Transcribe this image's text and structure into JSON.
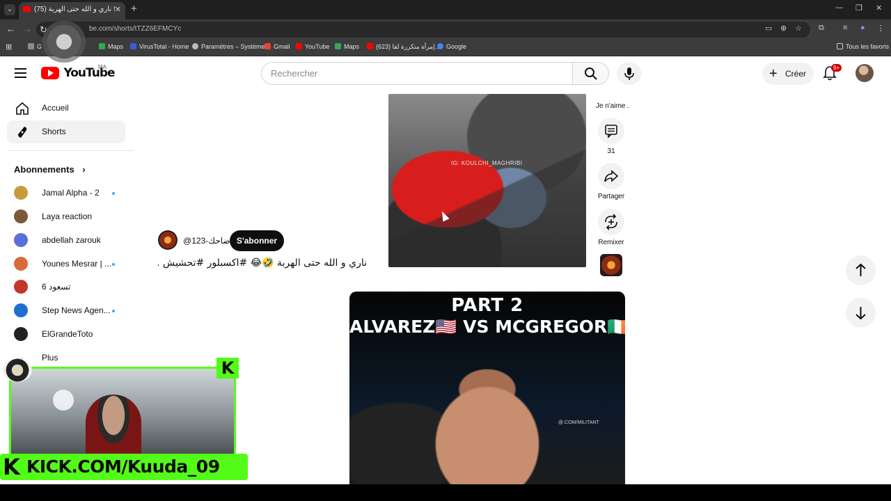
{
  "browser": {
    "tab_title": "(75) ناري و الله حتى الهربة ! ",
    "url": "be.com/shorts/tTZZ6EFMCYc",
    "bookmarks": [
      {
        "label": "G",
        "color": "#8c8c8c"
      },
      {
        "label": "Maps",
        "color": "#34a853"
      },
      {
        "label": "VirusTotal - Home",
        "color": "#3b5bdb"
      },
      {
        "label": "Paramètres – Système",
        "color": "#bdbdbd"
      },
      {
        "label": "Gmail",
        "color": "#ea4335"
      },
      {
        "label": "YouTube",
        "color": "#ff0000"
      },
      {
        "label": "Maps",
        "color": "#34a853"
      },
      {
        "label": "(623) إمرأة متكررة لقا...",
        "color": "#ff0000"
      },
      {
        "label": "Google",
        "color": "#4285f4"
      }
    ],
    "all_bookmarks_label": "Tous les favoris"
  },
  "header": {
    "logo_text": "YouTube",
    "country_code": "MA",
    "search_placeholder": "Rechercher",
    "create_label": "Créer",
    "notif_badge": "9+"
  },
  "sidebar": {
    "items": [
      {
        "label": "Accueil"
      },
      {
        "label": "Shorts"
      }
    ],
    "subscriptions_title": "Abonnements",
    "subscriptions": [
      {
        "label": "Jamal Alpha - 2",
        "color": "#c79a3c",
        "live": true
      },
      {
        "label": "Laya reaction",
        "color": "#7a5a3a",
        "live": false
      },
      {
        "label": "abdellah zarouk",
        "color": "#5a6fd8",
        "live": false
      },
      {
        "label": "Younes Mesrar | ...",
        "color": "#d96b3a",
        "live": true
      },
      {
        "label": "تسعود 6",
        "color": "#c0392b",
        "live": false
      },
      {
        "label": "Step News Agen...",
        "color": "#1f6fd1",
        "live": true
      },
      {
        "label": "ElGrandeToto",
        "color": "#222222",
        "live": false
      }
    ],
    "more_label": "Plus"
  },
  "short1": {
    "watermark": "IG: KOULCHI_MAGHRIBI",
    "channel": "@ضاحك-123",
    "subscribe_label": "S'abonner",
    "title": "ناري و الله حتى الهربة 🤣😂 #اكسبلور #تحشيش ..."
  },
  "actions": {
    "dislike_label": "Je n'aime .",
    "comments_count": "31",
    "share_label": "Partager",
    "remix_label": "Remixer"
  },
  "short2": {
    "line1": "PART 2",
    "line2": "ALVAREZ🇺🇸 VS MCGREGOR🇮🇪",
    "watermark": "@.COM/MILITANT"
  },
  "overlay": {
    "kick_letter": "K",
    "kick_url": "KICK.COM/Kuuda_09"
  },
  "colors": {
    "kick_green": "#53fc18",
    "youtube_red": "#ff0000"
  }
}
